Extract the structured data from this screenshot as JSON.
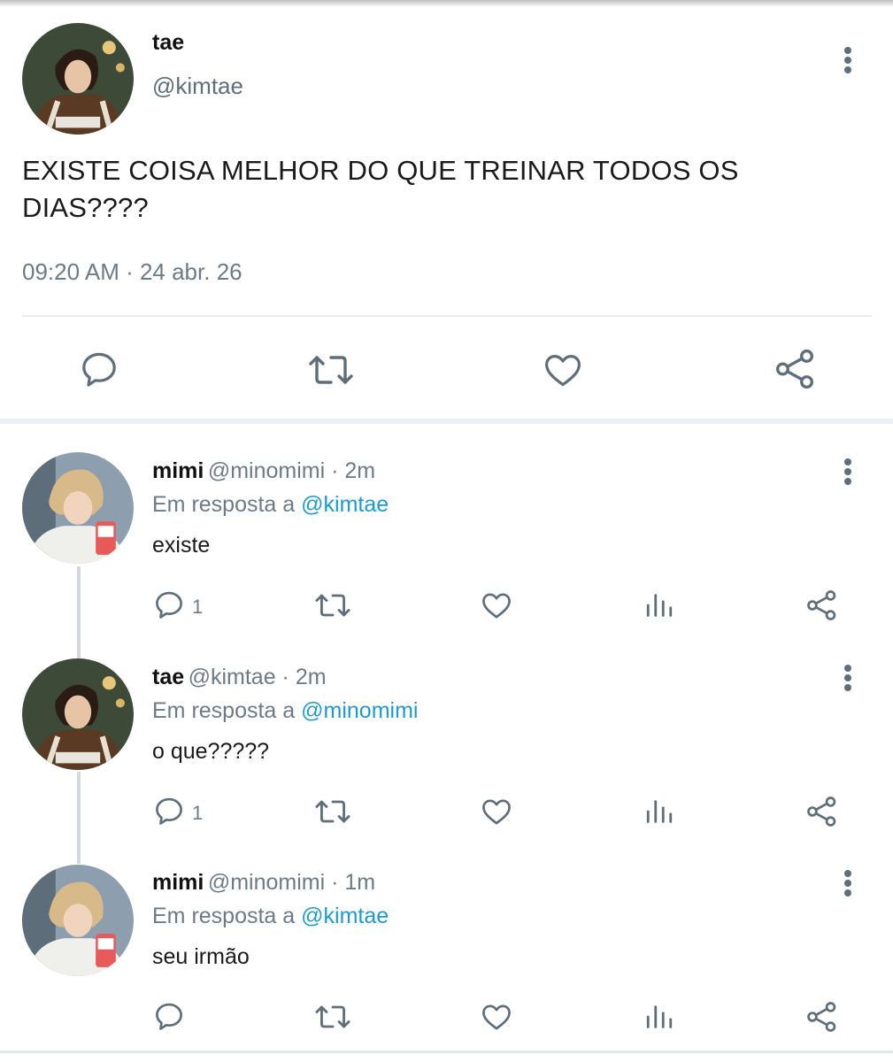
{
  "main_tweet": {
    "name": "tae",
    "handle": "@kimtae",
    "text": "EXISTE COISA MELHOR DO QUE TREINAR TODOS OS DIAS????",
    "timestamp": "09:20 AM · 24 abr. 26",
    "actions": [
      "comment-icon",
      "retweet-icon",
      "heart-icon",
      "share-icon"
    ]
  },
  "replies": [
    {
      "name": "mimi",
      "meta": "@minomimi · 2m",
      "reply_prefix": "Em resposta a",
      "reply_to": "@kimtae",
      "text": "existe",
      "comment_count": "1"
    },
    {
      "name": "tae",
      "meta": "@kimtae · 2m",
      "reply_prefix": "Em resposta a",
      "reply_to": "@minomimi",
      "text": "o que?????",
      "comment_count": "1"
    },
    {
      "name": "mimi",
      "meta": "@minomimi · 1m",
      "reply_prefix": "Em resposta a",
      "reply_to": "@kimtae",
      "text": "seu irmão",
      "comment_count": ""
    }
  ],
  "colors": {
    "mention": "#1d9bd1",
    "icon": "#5f6e7a",
    "secondary_text": "#6d7b86"
  }
}
